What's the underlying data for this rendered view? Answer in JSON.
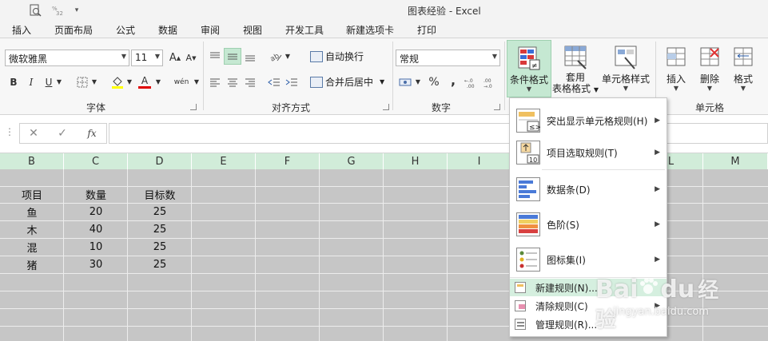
{
  "app": {
    "title": "图表经验 - Excel"
  },
  "quick_access": {
    "icons": [
      "search-preview-icon",
      "number-format-icon",
      "dropdown-icon"
    ]
  },
  "tabs": [
    "插入",
    "页面布局",
    "公式",
    "数据",
    "审阅",
    "视图",
    "开发工具",
    "新建选项卡",
    "打印"
  ],
  "ribbon": {
    "font": {
      "name": "微软雅黑",
      "size": "11",
      "grow_label": "A",
      "shrink_label": "A",
      "bold": "B",
      "italic": "I",
      "underline": "U",
      "font_color_label": "A",
      "phonetic_label": "wén",
      "group_label": "字体"
    },
    "alignment": {
      "wrap_text": "自动换行",
      "merge_center": "合并后居中",
      "group_label": "对齐方式"
    },
    "number": {
      "format": "常规",
      "percent": "%",
      "comma": ",",
      "group_label": "数字"
    },
    "styles": {
      "conditional_formatting": "条件格式",
      "format_as_table_line1": "套用",
      "format_as_table_line2": "表格格式",
      "cell_styles": "单元格样式"
    },
    "cells": {
      "insert": "插入",
      "delete": "删除",
      "format": "格式",
      "group_label": "单元格"
    }
  },
  "formula_bar": {
    "cancel": "✕",
    "enter": "✓",
    "fx": "fx",
    "value": ""
  },
  "sheet": {
    "columns": [
      "B",
      "C",
      "D",
      "E",
      "F",
      "G",
      "H",
      "I",
      "L",
      "M"
    ],
    "rows": [
      [
        "项目",
        "数量",
        "目标数"
      ],
      [
        "鱼",
        "20",
        "25"
      ],
      [
        "木",
        "40",
        "25"
      ],
      [
        "混",
        "10",
        "25"
      ],
      [
        "猪",
        "30",
        "25"
      ]
    ]
  },
  "colors": {
    "accent_green": "#217346",
    "header_green": "#d1ecd9",
    "highlight": "#d5efdf",
    "grid_gray": "#c6c6c6"
  },
  "cf_menu": {
    "items": [
      {
        "label": "突出显示单元格规则(H)",
        "icon": "highlight-rules-icon",
        "has_submenu": true
      },
      {
        "label": "项目选取规则(T)",
        "icon": "top-bottom-rules-icon",
        "has_submenu": true
      },
      {
        "label": "数据条(D)",
        "icon": "data-bars-icon",
        "has_submenu": true
      },
      {
        "label": "色阶(S)",
        "icon": "color-scales-icon",
        "has_submenu": true
      },
      {
        "label": "图标集(I)",
        "icon": "icon-sets-icon",
        "has_submenu": true
      }
    ],
    "small_items": [
      {
        "label": "新建规则(N)...",
        "icon": "new-rule-icon",
        "has_submenu": false
      },
      {
        "label": "清除规则(C)",
        "icon": "clear-rules-icon",
        "has_submenu": true
      },
      {
        "label": "管理规则(R)...",
        "icon": "manage-rules-icon",
        "has_submenu": false
      }
    ]
  },
  "watermark": {
    "brand": "Bai",
    "brand2": "du",
    "suffix": "经验",
    "url": "jingyan.baidu.com"
  }
}
